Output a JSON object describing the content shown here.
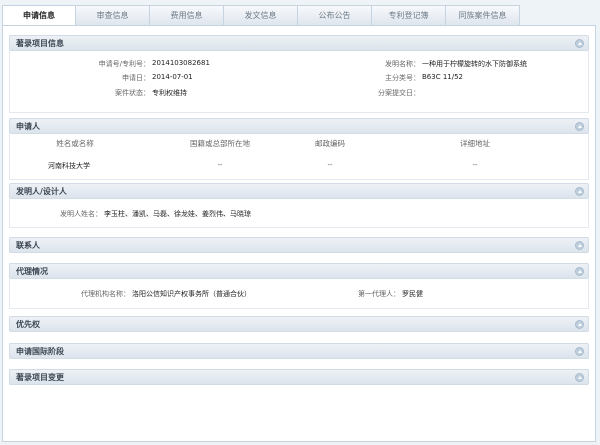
{
  "tabs": [
    {
      "label": "申请信息",
      "active": true
    },
    {
      "label": "审查信息"
    },
    {
      "label": "费用信息"
    },
    {
      "label": "发文信息"
    },
    {
      "label": "公布公告"
    },
    {
      "label": "专利登记簿"
    },
    {
      "label": "同族案件信息"
    }
  ],
  "bibliographic": {
    "title": "著录项目信息",
    "app_no_label": "申请号/专利号：",
    "app_no": "2014103082681",
    "app_date_label": "申请日：",
    "app_date": "2014-07-01",
    "status_label": "案件状态：",
    "status": "专利权维持",
    "invention_name_label": "发明名称：",
    "invention_name": "一种用于柠檬旋转的水下防御系统",
    "main_class_label": "主分类号：",
    "main_class": "B63C 11/52",
    "division_date_label": "分案提交日："
  },
  "applicant": {
    "title": "申请人",
    "columns": [
      "姓名或名称",
      "国籍或总部所在地",
      "邮政编码",
      "详细地址"
    ],
    "rows": [
      {
        "name": "河南科技大学",
        "country": "--",
        "postcode": "--",
        "address": "--"
      }
    ]
  },
  "inventor": {
    "title": "发明人/设计人",
    "label": "发明人姓名：",
    "names": "李玉柱、潘凯、马磊、徐龙娃、姜烈伟、马晓琼"
  },
  "contact": {
    "title": "联系人"
  },
  "agency": {
    "title": "代理情况",
    "agency_label": "代理机构名称：",
    "agency_name": "洛阳公信知识产权事务所（普通合伙）",
    "agent_label": "第一代理人：",
    "agent_name": "罗民健"
  },
  "priority": {
    "title": "优先权"
  },
  "pct": {
    "title": "申请国际阶段"
  },
  "changes": {
    "title": "著录项目变更"
  }
}
